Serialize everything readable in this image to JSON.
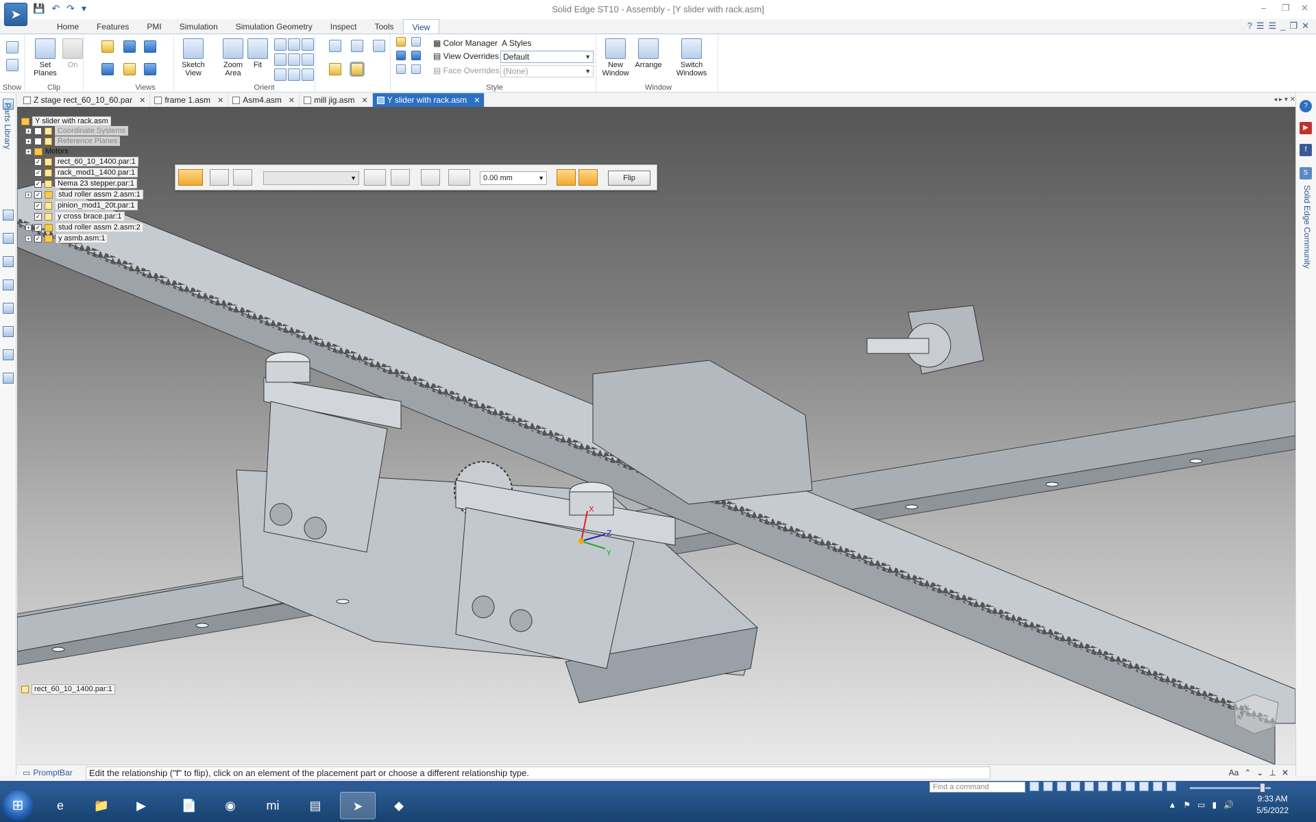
{
  "window": {
    "title": "Solid Edge ST10 - Assembly - [Y slider with rack.asm]"
  },
  "ribbon_tabs": [
    "Home",
    "Features",
    "PMI",
    "Simulation",
    "Simulation Geometry",
    "Inspect",
    "Tools",
    "View"
  ],
  "active_tab": "View",
  "ribbon": {
    "show": {
      "label": "Show"
    },
    "clip": {
      "label": "Clip",
      "set_planes": "Set Planes",
      "on": "On"
    },
    "views": {
      "label": "Views",
      "sketch_view": "Sketch View"
    },
    "orient": {
      "label": "Orient",
      "zoom_area": "Zoom Area",
      "fit": "Fit"
    },
    "style": {
      "label": "Style",
      "color_manager": "Color Manager",
      "styles": "Styles",
      "view_overrides_label": "View Overrides",
      "view_overrides_value": "Default",
      "face_overrides_label": "Face Overrides",
      "face_overrides_value": "(None)"
    },
    "window": {
      "label": "Window",
      "new_window": "New Window",
      "arrange": "Arrange",
      "switch_windows": "Switch Windows"
    }
  },
  "doc_tabs": [
    {
      "label": "Z stage rect_60_10_60.par",
      "active": false
    },
    {
      "label": "frame 1.asm",
      "active": false
    },
    {
      "label": "Asm4.asm",
      "active": false
    },
    {
      "label": "mill jig.asm",
      "active": false
    },
    {
      "label": "Y slider with rack.asm",
      "active": true
    }
  ],
  "left_panel": {
    "parts_library": "Parts Library"
  },
  "right_panel": {
    "community": "Solid Edge Community"
  },
  "tree": {
    "root": "Y slider with rack.asm",
    "items": [
      {
        "label": "Coordinate Systems",
        "checked": false,
        "dim": true
      },
      {
        "label": "Reference Planes",
        "checked": false,
        "dim": true
      },
      {
        "label": "Motors",
        "checked": null,
        "dim": false
      },
      {
        "label": "rect_60_10_1400.par:1",
        "checked": true,
        "dim": false
      },
      {
        "label": "rack_mod1_1400.par:1",
        "checked": true,
        "dim": false
      },
      {
        "label": "Nema 23 stepper.par:1",
        "checked": true,
        "dim": false
      },
      {
        "label": "stud roller assm 2.asm:1",
        "checked": true,
        "dim": false
      },
      {
        "label": "pinion_mod1_20t.par:1",
        "checked": true,
        "dim": false
      },
      {
        "label": "y cross brace.par:1",
        "checked": true,
        "dim": false
      },
      {
        "label": "stud roller assm 2.asm:2",
        "checked": true,
        "dim": false
      },
      {
        "label": "y asmb.asm:1",
        "checked": true,
        "dim": false
      }
    ]
  },
  "command_bar": {
    "offset_value": "0.00 mm",
    "flip_label": "Flip"
  },
  "selected_part_label": "rect_60_10_1400.par:1",
  "view_cube_face": "BACK",
  "triad_labels": {
    "x": "X",
    "y": "Y",
    "z": "Z"
  },
  "prompt_bar": {
    "title": "PromptBar",
    "text": "Edit the relationship (\"f\" to flip), click on an element of the placement part or choose a different relationship type."
  },
  "status": {
    "find_placeholder": "Find a command"
  },
  "taskbar": {
    "time": "9:33 AM",
    "date": "5/5/2022"
  }
}
